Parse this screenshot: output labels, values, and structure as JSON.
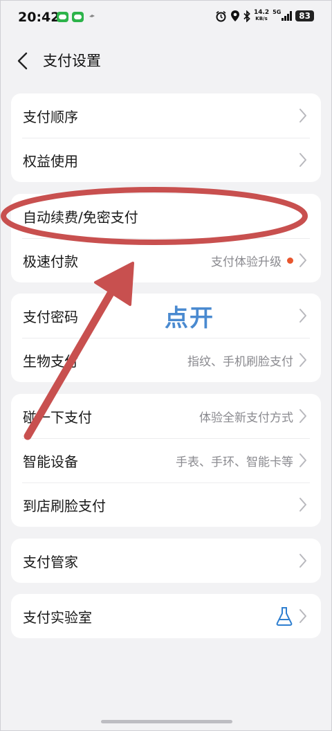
{
  "status_bar": {
    "time": "20:42",
    "net_speed_value": "14.2",
    "net_speed_unit": "KB/s",
    "network_type": "5G",
    "battery": "83"
  },
  "header": {
    "title": "支付设置"
  },
  "groups": [
    {
      "items": [
        {
          "label": "支付顺序"
        },
        {
          "label": "权益使用"
        }
      ]
    },
    {
      "items": [
        {
          "label": "自动续费/免密支付"
        },
        {
          "label": "极速付款",
          "value": "支付体验升级",
          "badge_color": "#e8562e"
        }
      ]
    },
    {
      "items": [
        {
          "label": "支付密码"
        },
        {
          "label": "生物支付",
          "value": "指纹、手机刷脸支付"
        }
      ]
    },
    {
      "items": [
        {
          "label": "碰一下支付",
          "value": "体验全新支付方式"
        },
        {
          "label": "智能设备",
          "value": "手表、手环、智能卡等"
        },
        {
          "label": "到店刷脸支付"
        }
      ]
    },
    {
      "items": [
        {
          "label": "支付管家"
        }
      ]
    },
    {
      "items": [
        {
          "label": "支付实验室",
          "icon": "flask-icon"
        }
      ]
    }
  ],
  "annotation": {
    "text": "点开",
    "ellipse_color": "#c8504f",
    "arrow_color": "#c8504f",
    "text_color": "#4a8ad0"
  }
}
